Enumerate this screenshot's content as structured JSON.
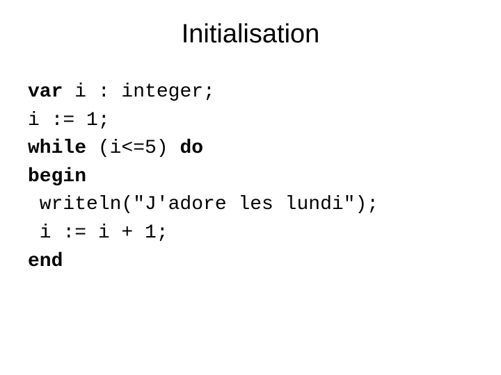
{
  "title": "Initialisation",
  "code": {
    "line1_kw": "var",
    "line1_rest": " i : integer;",
    "line2": "i := 1;",
    "line3_kw1": "while",
    "line3_mid": " (i<=5) ",
    "line3_kw2": "do",
    "line4_kw": "begin",
    "line5": " writeln(\"J'adore les lundi\");",
    "line6": " i := i + 1;",
    "line7_kw": "end"
  }
}
